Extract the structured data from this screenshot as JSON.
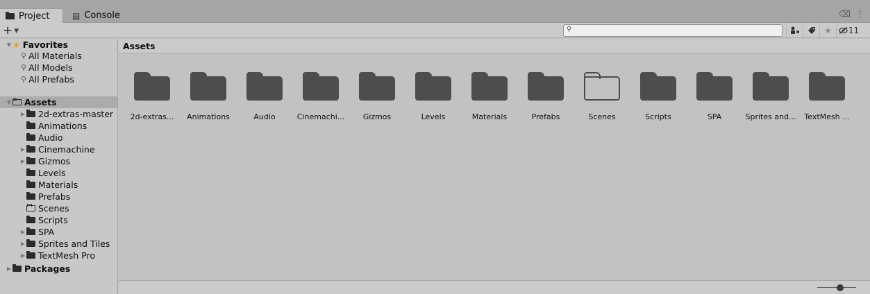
{
  "tabs": [
    {
      "label": "Project",
      "icon": "folder-icon",
      "active": true
    },
    {
      "label": "Console",
      "icon": "console-icon",
      "active": false
    }
  ],
  "window_controls": {
    "lock": "🔒",
    "more": "⋮"
  },
  "toolbar": {
    "create_label": "+",
    "search": {
      "value": "",
      "placeholder": ""
    },
    "hidden_count": "11"
  },
  "sidebar": {
    "favorites": {
      "label": "Favorites",
      "items": [
        "All Materials",
        "All Models",
        "All Prefabs"
      ]
    },
    "assets": {
      "label": "Assets",
      "items": [
        {
          "label": "2d-extras-master",
          "expandable": true,
          "empty": false
        },
        {
          "label": "Animations",
          "expandable": false,
          "empty": false
        },
        {
          "label": "Audio",
          "expandable": false,
          "empty": false
        },
        {
          "label": "Cinemachine",
          "expandable": true,
          "empty": false
        },
        {
          "label": "Gizmos",
          "expandable": true,
          "empty": false
        },
        {
          "label": "Levels",
          "expandable": false,
          "empty": false
        },
        {
          "label": "Materials",
          "expandable": false,
          "empty": false
        },
        {
          "label": "Prefabs",
          "expandable": false,
          "empty": false
        },
        {
          "label": "Scenes",
          "expandable": false,
          "empty": true
        },
        {
          "label": "Scripts",
          "expandable": false,
          "empty": false
        },
        {
          "label": "SPA",
          "expandable": true,
          "empty": false
        },
        {
          "label": "Sprites and Tiles",
          "expandable": true,
          "empty": false
        },
        {
          "label": "TextMesh Pro",
          "expandable": true,
          "empty": false
        }
      ]
    },
    "packages": {
      "label": "Packages"
    }
  },
  "main": {
    "breadcrumb": "Assets",
    "folders": [
      {
        "label": "2d-extras...",
        "empty": false
      },
      {
        "label": "Animations",
        "empty": false
      },
      {
        "label": "Audio",
        "empty": false
      },
      {
        "label": "Cinemachi...",
        "empty": false
      },
      {
        "label": "Gizmos",
        "empty": false
      },
      {
        "label": "Levels",
        "empty": false
      },
      {
        "label": "Materials",
        "empty": false
      },
      {
        "label": "Prefabs",
        "empty": false
      },
      {
        "label": "Scenes",
        "empty": true
      },
      {
        "label": "Scripts",
        "empty": false
      },
      {
        "label": "SPA",
        "empty": false
      },
      {
        "label": "Sprites and...",
        "empty": false
      },
      {
        "label": "TextMesh ...",
        "empty": false
      }
    ]
  },
  "zoom_slider": {
    "value": 0.6
  }
}
